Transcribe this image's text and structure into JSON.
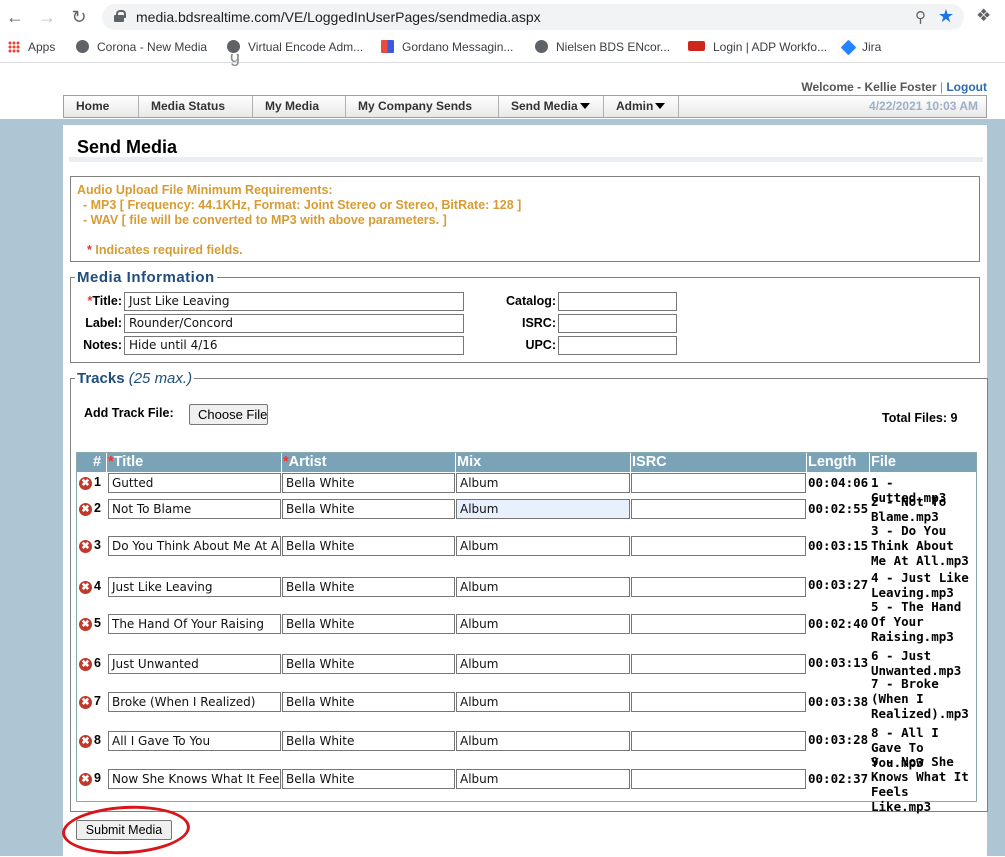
{
  "browser": {
    "url": "media.bdsrealtime.com/VE/LoggedInUserPages/sendmedia.aspx",
    "bookmarks": [
      {
        "label": "Apps",
        "icon": "apps-grid-icon"
      },
      {
        "label": "Corona - New Media",
        "icon": "globe-icon"
      },
      {
        "label": "Virtual Encode Adm...",
        "icon": "globe-icon"
      },
      {
        "label": "Gordano Messagin...",
        "icon": "gordano-logo-icon"
      },
      {
        "label": "Nielsen BDS ENcor...",
        "icon": "globe-icon"
      },
      {
        "label": "Login | ADP Workfo...",
        "icon": "adp-logo-icon"
      },
      {
        "label": "Jira",
        "icon": "jira-logo-icon"
      }
    ]
  },
  "header": {
    "welcome": "Welcome - Kellie Foster",
    "separator": "|",
    "logout": "Logout",
    "datetime": "4/22/2021 10:03 AM"
  },
  "menu": {
    "items": [
      "Home",
      "Media Status",
      "My Media",
      "My Company Sends",
      "Send Media",
      "Admin"
    ]
  },
  "page": {
    "title": "Send Media"
  },
  "requirements": {
    "line1": "Audio Upload File Minimum Requirements:",
    "line2": "- MP3  [ Frequency: 44.1KHz, Format: Joint Stereo or Stereo, BitRate: 128 ]",
    "line3": "- WAV [ file will be converted to MP3 with above parameters. ]",
    "required_note": "Indicates required fields.",
    "asterisk": "*"
  },
  "media_info": {
    "legend": "Media Information",
    "title_label": "Title:",
    "title_value": "Just Like Leaving",
    "label_label": "Label:",
    "label_value": "Rounder/Concord",
    "notes_label": "Notes:",
    "notes_value": "Hide until 4/16",
    "catalog_label": "Catalog:",
    "catalog_value": "",
    "isrc_label": "ISRC:",
    "isrc_value": "",
    "upc_label": "UPC:",
    "upc_value": ""
  },
  "tracks": {
    "legend": "Tracks",
    "legend_max": "(25 max.)",
    "add_track_label": "Add Track File:",
    "choose_file_label": "Choose File",
    "total_files": "Total Files: 9",
    "columns": {
      "num": "#",
      "title": "Title",
      "artist": "Artist",
      "mix": "Mix",
      "isrc": "ISRC",
      "length": "Length",
      "file": "File"
    },
    "rows": [
      {
        "num": "1",
        "title": "Gutted",
        "artist": "Bella White",
        "mix": "Album",
        "isrc": "",
        "length": "00:04:06",
        "file": "1 - Gutted.mp3"
      },
      {
        "num": "2",
        "title": "Not To Blame",
        "artist": "Bella White",
        "mix": "Album",
        "isrc": "",
        "length": "00:02:55",
        "file": "2 - Not To Blame.mp3"
      },
      {
        "num": "3",
        "title": "Do You Think About Me At A",
        "artist": "Bella White",
        "mix": "Album",
        "isrc": "",
        "length": "00:03:15",
        "file": "3 - Do You Think About Me At All.mp3"
      },
      {
        "num": "4",
        "title": "Just Like Leaving",
        "artist": "Bella White",
        "mix": "Album",
        "isrc": "",
        "length": "00:03:27",
        "file": "4 - Just Like Leaving.mp3"
      },
      {
        "num": "5",
        "title": "The Hand Of Your Raising",
        "artist": "Bella White",
        "mix": "Album",
        "isrc": "",
        "length": "00:02:40",
        "file": "5 - The Hand Of Your Raising.mp3"
      },
      {
        "num": "6",
        "title": "Just Unwanted",
        "artist": "Bella White",
        "mix": "Album",
        "isrc": "",
        "length": "00:03:13",
        "file": "6 - Just Unwanted.mp3"
      },
      {
        "num": "7",
        "title": "Broke (When I Realized)",
        "artist": "Bella White",
        "mix": "Album",
        "isrc": "",
        "length": "00:03:38",
        "file": "7 - Broke (When I Realized).mp3"
      },
      {
        "num": "8",
        "title": "All I Gave To You",
        "artist": "Bella White",
        "mix": "Album",
        "isrc": "",
        "length": "00:03:28",
        "file": "8 - All I Gave To You.mp3"
      },
      {
        "num": "9",
        "title": "Now She Knows What It Fee",
        "artist": "Bella White",
        "mix": "Album",
        "isrc": "",
        "length": "00:02:37",
        "file": "9 - Now She Knows What It Feels Like.mp3"
      }
    ]
  },
  "submit_label": "Submit Media",
  "colors": {
    "accent_orange": "#d79c33",
    "legend_blue": "#1f4e7a",
    "table_header": "#7aa3b8",
    "annotation_red": "#d8151b"
  }
}
